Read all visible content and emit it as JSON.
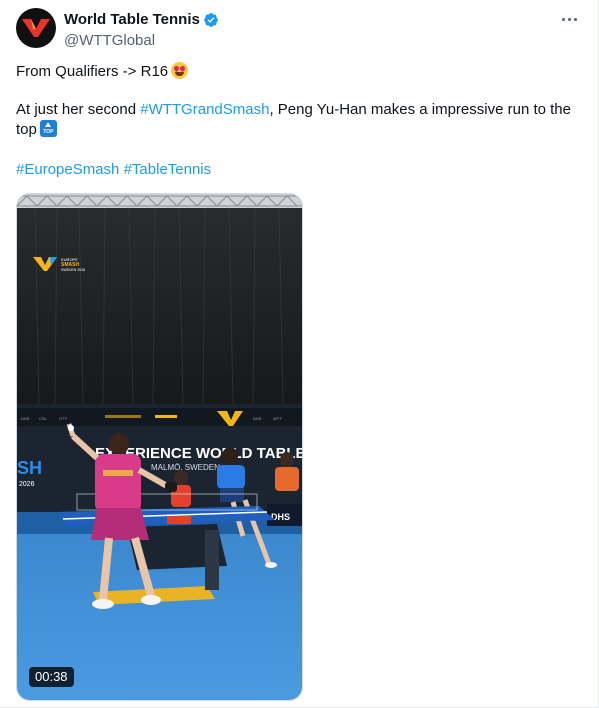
{
  "post": {
    "author": {
      "display_name": "World Table Tennis",
      "handle": "@WTTGlobal",
      "verified": true,
      "avatar_icon": "wtt-logo-icon"
    },
    "more_icon": "more-options-icon",
    "text": {
      "line1": "From Qualifiers -> R16",
      "line1_emoji": "heart-eyes-emoji",
      "line2_prefix": "At just her second ",
      "line2_hashtag": "#WTTGrandSmash",
      "line2_suffix": ", Peng Yu-Han makes a impressive run to the top",
      "line2_emoji": "top-arrow-emoji",
      "hashtag1": "#EuropeSmash",
      "hashtag2": "#TableTennis"
    },
    "media": {
      "type": "video",
      "duration": "00:38",
      "scene_banner": "EXPERIENCE WORLD TABLE",
      "scene_sub": "MALMÖ, SWEDEN",
      "scene_left": "SH",
      "scene_year": "2026",
      "scene_logo_text": "EUROPE SMASH SWEDEN 2026"
    },
    "colors": {
      "link": "#1d9bf0",
      "verified": "#1d9bf0",
      "text_secondary": "#536471",
      "court_floor": "#3f8fd4",
      "player_jersey": "#d93a8a"
    }
  }
}
